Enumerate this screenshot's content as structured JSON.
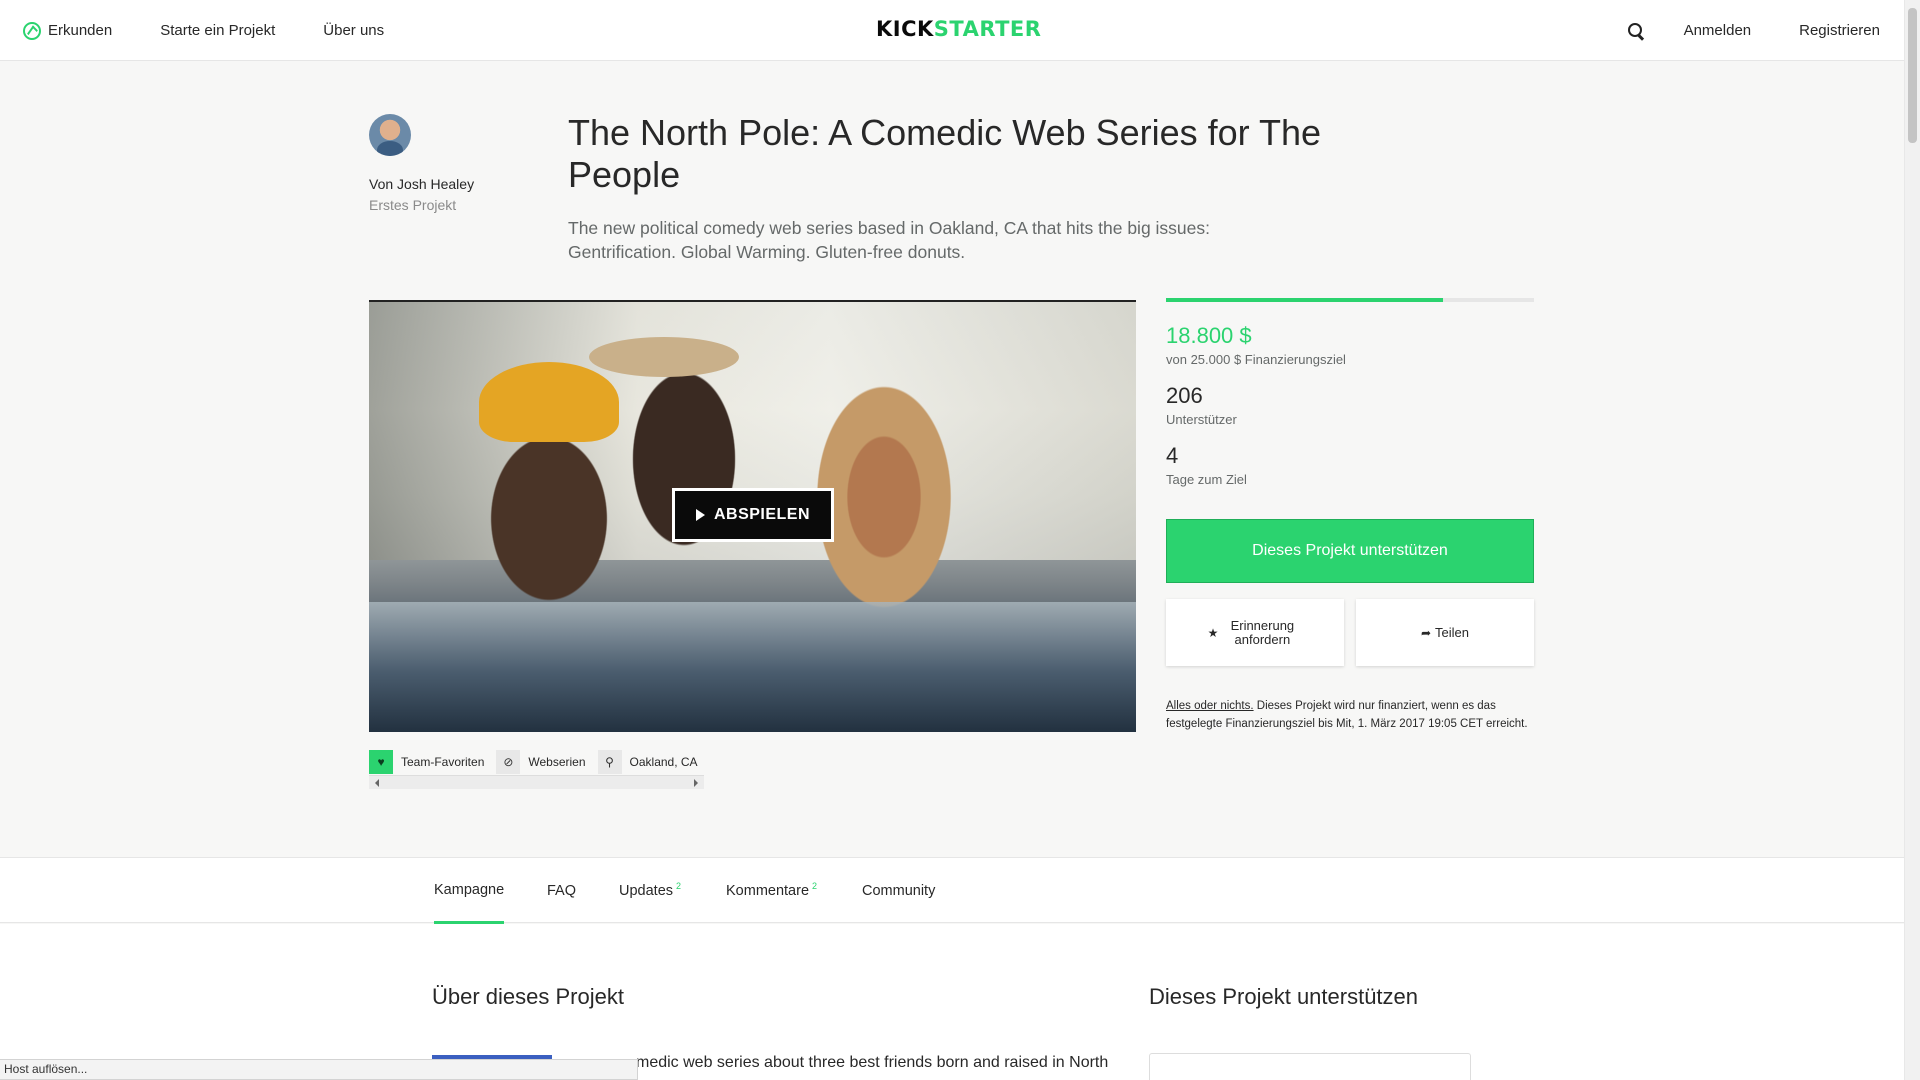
{
  "nav": {
    "explore": "Erkunden",
    "start": "Starte ein Projekt",
    "about": "Über uns",
    "logo_kick": "KICK",
    "logo_starter": "STARTER",
    "login": "Anmelden",
    "signup": "Registrieren"
  },
  "project": {
    "creator_name": "Von Josh Healey",
    "creator_sub": "Erstes Projekt",
    "title": "The North Pole: A Comedic Web Series for The People",
    "blurb": "The new political comedy web series based in Oakland, CA that hits the big issues: Gentrification. Global Warming. Gluten-free donuts.",
    "play_label": "ABSPIELEN"
  },
  "tags": {
    "team_fav": "Team-Favoriten",
    "category": "Webserien",
    "location": "Oakland, CA"
  },
  "stats": {
    "funded_fraction": 0.752,
    "pledged": "18.800 $",
    "goal": "von 25.000 $ Finanzierungsziel",
    "backers": "206",
    "backers_label": "Unterstützer",
    "days": "4",
    "days_label": "Tage zum Ziel",
    "back_label": "Dieses Projekt unterstützen",
    "remind_label": "Erinnerung anfordern",
    "share_label": "Teilen",
    "aon_link": "Alles oder nichts.",
    "aon_text": " Dieses Projekt wird nur finanziert, wenn es das festgelegte Finanzierungsziel bis Mit, 1. März 2017 19:05 CET erreicht."
  },
  "tabs": {
    "campaign": "Kampagne",
    "faq": "FAQ",
    "updates": "Updates",
    "updates_count": "2",
    "comments": "Kommentare",
    "comments_count": "2",
    "community": "Community"
  },
  "lower": {
    "about_heading": "Über dieses Projekt",
    "support_heading": "Dieses Projekt unterstützen",
    "about_text": "medic web series about three best friends born and raised in North"
  },
  "status": {
    "text": "Host auflösen..."
  },
  "colors": {
    "accent": "#2bd36f",
    "text": "#282828"
  }
}
